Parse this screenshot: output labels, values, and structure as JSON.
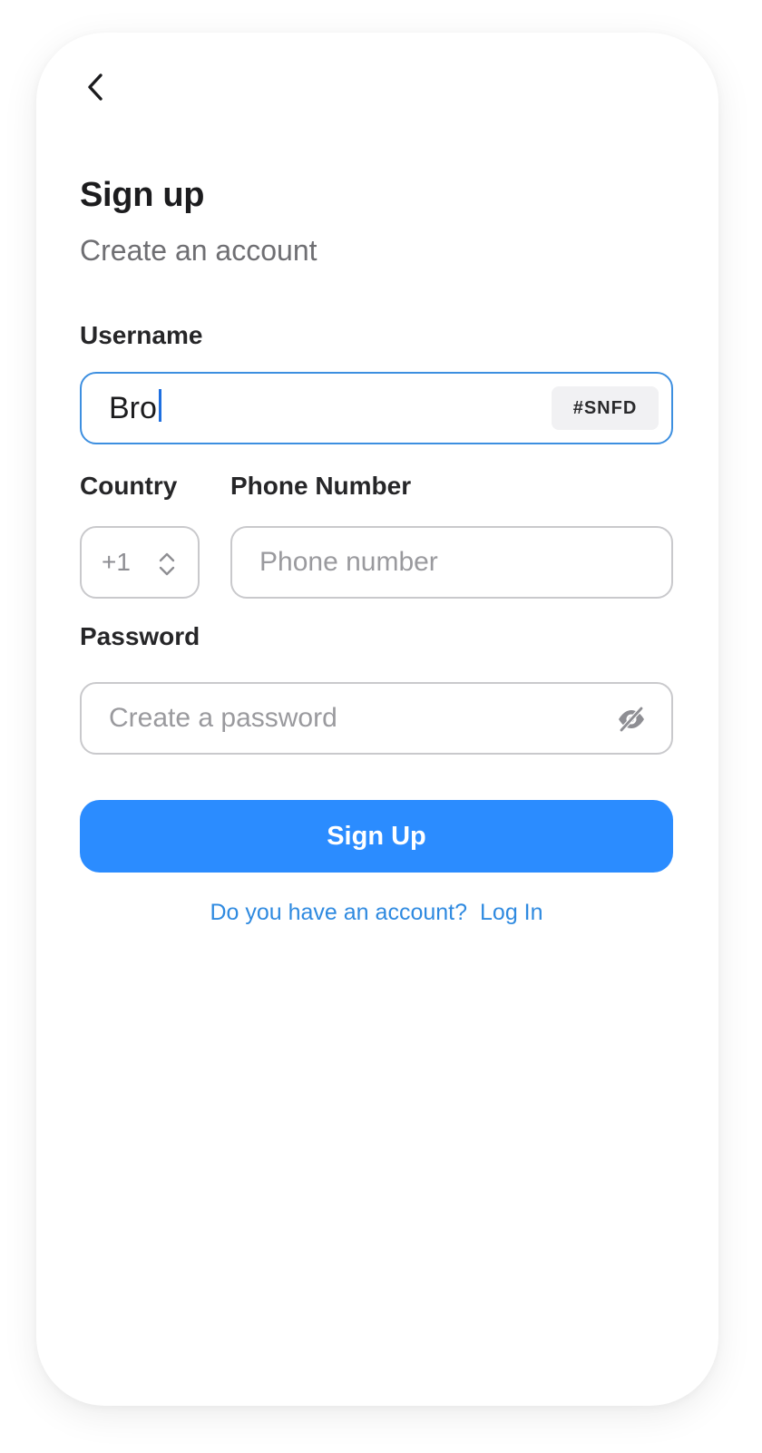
{
  "header": {
    "back_icon": "chevron-left-icon",
    "title": "Sign up",
    "subtitle": "Create an account"
  },
  "form": {
    "username": {
      "label": "Username",
      "value": "Bro",
      "tag": "#SNFD"
    },
    "country": {
      "label": "Country",
      "value": "+1",
      "icon": "up-down-chevron-icon"
    },
    "phone": {
      "label": "Phone Number",
      "placeholder": "Phone number",
      "value": ""
    },
    "password": {
      "label": "Password",
      "placeholder": "Create a password",
      "value": "",
      "icon": "eye-off-icon"
    },
    "submit_label": "Sign Up"
  },
  "footer": {
    "prompt": "Do you have an account?",
    "link_label": "Log In"
  },
  "colors": {
    "accent": "#2b8cff",
    "focus_border": "#3d8fe0",
    "link": "#2f8ae0",
    "caret": "#1e6fe0"
  }
}
